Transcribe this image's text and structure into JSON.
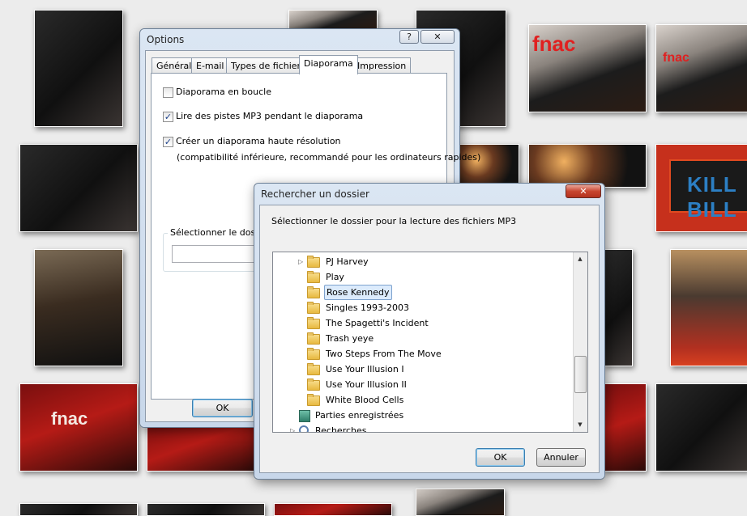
{
  "options_dialog": {
    "title": "Options",
    "help_label": "?",
    "close_label": "✕",
    "tabs": [
      {
        "label": "Général"
      },
      {
        "label": "E-mail"
      },
      {
        "label": "Types de fichiers"
      },
      {
        "label": "Diaporama"
      },
      {
        "label": "Impression"
      }
    ],
    "active_tab": "Diaporama",
    "checkboxes": [
      {
        "label": "Diaporama en boucle",
        "checked": false
      },
      {
        "label": "Lire des pistes MP3 pendant le diaporama",
        "checked": true
      },
      {
        "label": "Créer un diaporama haute résolution",
        "checked": true
      }
    ],
    "hires_note": "(compatibilité inférieure, recommandé pour les ordinateurs rapides)",
    "folder_group_label": "Sélectionner le dossie",
    "folder_value": "",
    "ok_label": "OK"
  },
  "browse_dialog": {
    "title": "Rechercher un dossier",
    "close_label": "✕",
    "prompt": "Sélectionner le dossier pour la lecture des fichiers MP3",
    "folders": [
      {
        "label": "PJ Harvey",
        "expandable": true,
        "selected": false
      },
      {
        "label": "Play",
        "expandable": false,
        "selected": false
      },
      {
        "label": "Rose Kennedy",
        "expandable": false,
        "selected": true
      },
      {
        "label": "Singles 1993-2003",
        "expandable": false,
        "selected": false
      },
      {
        "label": "The Spagetti's Incident",
        "expandable": false,
        "selected": false
      },
      {
        "label": "Trash yeye",
        "expandable": false,
        "selected": false
      },
      {
        "label": "Two Steps From The Move",
        "expandable": false,
        "selected": false
      },
      {
        "label": "Use Your Illusion I",
        "expandable": false,
        "selected": false
      },
      {
        "label": "Use Your Illusion II",
        "expandable": false,
        "selected": false
      },
      {
        "label": "White Blood Cells",
        "expandable": false,
        "selected": false
      }
    ],
    "parent_items": [
      {
        "label": "Parties enregistrées",
        "icon": "saved-games-icon"
      },
      {
        "label": "Recherches",
        "icon": "searches-icon"
      }
    ],
    "ok_label": "OK",
    "cancel_label": "Annuler"
  },
  "background_photos": {
    "poster_text": "KILL BILL",
    "store_logo": "fnac"
  }
}
